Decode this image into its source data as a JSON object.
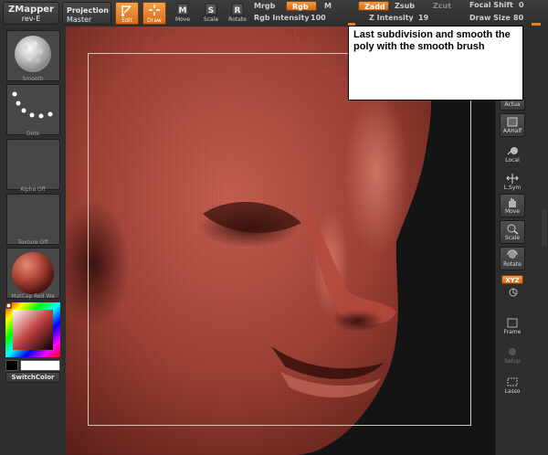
{
  "menu": {
    "zmapper": {
      "line1": "ZMapper",
      "line2": "rev-E"
    },
    "projection": {
      "line1": "Projection",
      "line2": "Master"
    }
  },
  "tools": [
    {
      "name": "edit",
      "label": "Edit",
      "active": true
    },
    {
      "name": "draw",
      "label": "Draw",
      "active": true
    },
    {
      "name": "move",
      "label": "Move",
      "active": false
    },
    {
      "name": "scale",
      "label": "Scale",
      "active": false
    },
    {
      "name": "rotate",
      "label": "Rotate",
      "active": false
    }
  ],
  "params": {
    "mrgb": "Mrgb",
    "rgb": "Rgb",
    "m": "M",
    "rgb_intensity_label": "Rgb Intensity",
    "rgb_intensity_value": "100",
    "zadd": "Zadd",
    "zsub": "Zsub",
    "zcut": "Zcut",
    "z_intensity_label": "Z Intensity",
    "z_intensity_value": "19",
    "focal_shift_label": "Focal Shift",
    "focal_shift_value": "0",
    "draw_size_label": "Draw Size",
    "draw_size_value": "80"
  },
  "left_panel": {
    "brush": "Smooth",
    "stroke": "Dots",
    "alpha": "Alpha Off",
    "texture": "Texture Off",
    "material": "MatCap Red Wa",
    "switch_color": "SwitchColor"
  },
  "right_panel": [
    {
      "name": "actual",
      "label": "Actua",
      "icon": "actual-icon"
    },
    {
      "name": "aahalf",
      "label": "AAHalf",
      "icon": "aahalf-icon"
    },
    {
      "name": "local",
      "label": "Local",
      "icon": "local-icon"
    },
    {
      "name": "lsym",
      "label": "L.Sym",
      "icon": "symmetry-icon"
    },
    {
      "name": "move",
      "label": "Move",
      "icon": "hand-icon"
    },
    {
      "name": "scale",
      "label": "Scale",
      "icon": "scale-icon"
    },
    {
      "name": "rotate",
      "label": "Rotate",
      "icon": "rotate-icon"
    },
    {
      "name": "xyz",
      "label": "XYZ",
      "icon": "xyz-icon"
    },
    {
      "name": "frame",
      "label": "Frame",
      "icon": "frame-icon"
    },
    {
      "name": "setup",
      "label": "Setup",
      "icon": "setup-icon"
    },
    {
      "name": "lasso",
      "label": "Lasso",
      "icon": "lasso-icon"
    }
  ],
  "callout": {
    "text": "Last subdivision and smooth the poly with the smooth brush"
  },
  "colors": {
    "accent": "#e8801f",
    "sculpt": "#a0473c"
  }
}
